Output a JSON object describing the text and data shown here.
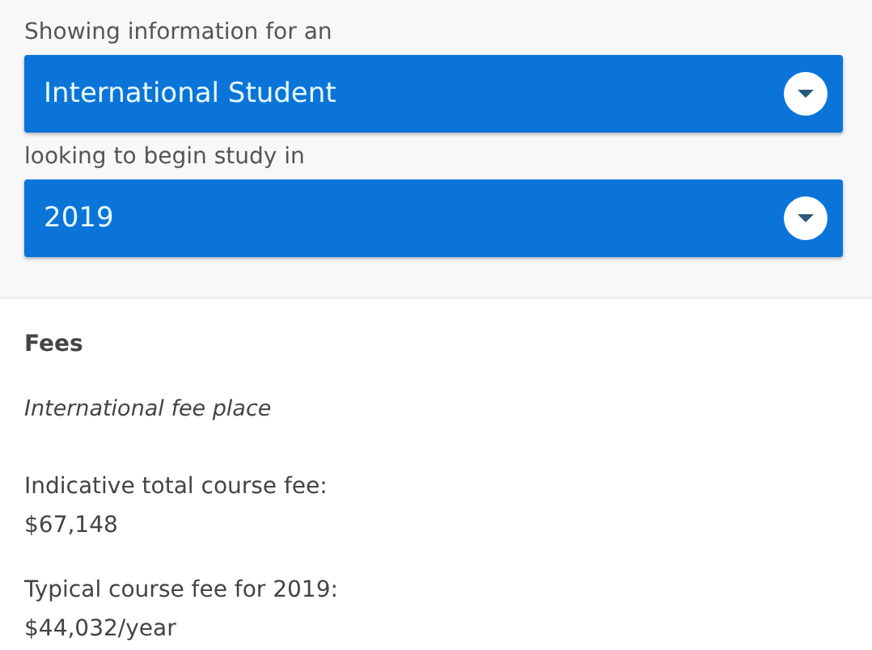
{
  "selectors": [
    {
      "label": "Showing information for an",
      "value": "International Student"
    },
    {
      "label": "looking to begin study in",
      "value": "2019"
    }
  ],
  "fees": {
    "heading": "Fees",
    "place_type": "International fee place",
    "items": [
      {
        "label": "Indicative total course fee:",
        "value": "$67,148"
      },
      {
        "label": "Typical course fee for 2019:",
        "value": "$44,032/year"
      }
    ]
  }
}
